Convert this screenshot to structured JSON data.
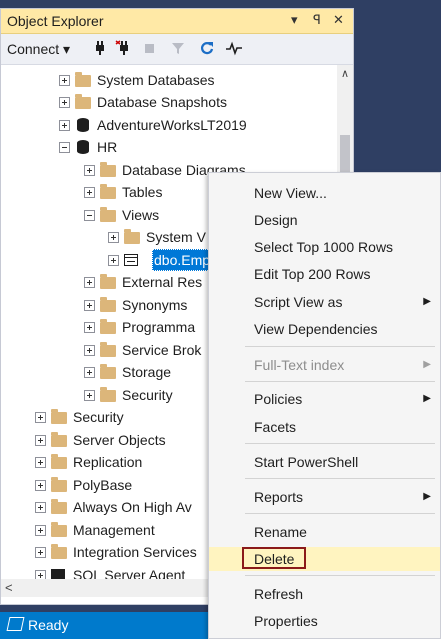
{
  "panel": {
    "title": "Object Explorer",
    "title_icons": [
      "▾",
      "ꟼ",
      "✕"
    ],
    "toolbar": {
      "connect_label": "Connect ▾",
      "icons": [
        "plug-icon",
        "disconnect-icon",
        "stop-icon",
        "filter-icon",
        "refresh-icon",
        "activity-icon"
      ]
    }
  },
  "tree": [
    {
      "label": "System Databases",
      "icon": "folder",
      "expander": "plus"
    },
    {
      "label": "Database Snapshots",
      "icon": "folder",
      "expander": "plus"
    },
    {
      "label": "AdventureWorksLT2019",
      "icon": "database",
      "expander": "plus"
    },
    {
      "label": "HR",
      "icon": "database",
      "expander": "minus"
    },
    {
      "label": "Database Diagrams",
      "icon": "folder",
      "expander": "plus"
    },
    {
      "label": "Tables",
      "icon": "folder",
      "expander": "plus"
    },
    {
      "label": "Views",
      "icon": "folder",
      "expander": "minus"
    },
    {
      "label": "System V",
      "icon": "folder",
      "expander": "plus"
    },
    {
      "label": "dbo.Emp",
      "icon": "view",
      "expander": "plus",
      "selected": true
    },
    {
      "label": "External Res",
      "icon": "folder",
      "expander": "plus"
    },
    {
      "label": "Synonyms",
      "icon": "folder",
      "expander": "plus"
    },
    {
      "label": "Programma",
      "icon": "folder",
      "expander": "plus"
    },
    {
      "label": "Service Brok",
      "icon": "folder",
      "expander": "plus"
    },
    {
      "label": "Storage",
      "icon": "folder",
      "expander": "plus"
    },
    {
      "label": "Security",
      "icon": "folder",
      "expander": "plus"
    },
    {
      "label": "Security",
      "icon": "folder",
      "expander": "plus"
    },
    {
      "label": "Server Objects",
      "icon": "folder",
      "expander": "plus"
    },
    {
      "label": "Replication",
      "icon": "folder",
      "expander": "plus"
    },
    {
      "label": "PolyBase",
      "icon": "folder",
      "expander": "plus"
    },
    {
      "label": "Always On High Av",
      "icon": "folder",
      "expander": "plus"
    },
    {
      "label": "Management",
      "icon": "folder",
      "expander": "plus"
    },
    {
      "label": "Integration Services",
      "icon": "folder",
      "expander": "plus"
    },
    {
      "label": "SQL Server Agent",
      "icon": "agent",
      "expander": "plus"
    }
  ],
  "context_menu": [
    {
      "label": "New View...",
      "submenu": false
    },
    {
      "label": "Design",
      "submenu": false
    },
    {
      "label": "Select Top 1000 Rows",
      "submenu": false
    },
    {
      "label": "Edit Top 200 Rows",
      "submenu": false
    },
    {
      "label": "Script View as",
      "submenu": true
    },
    {
      "label": "View Dependencies",
      "submenu": false
    },
    {
      "label": "Full-Text index",
      "submenu": true,
      "disabled": true
    },
    {
      "label": "Policies",
      "submenu": true
    },
    {
      "label": "Facets",
      "submenu": false
    },
    {
      "label": "Start PowerShell",
      "submenu": false
    },
    {
      "label": "Reports",
      "submenu": true
    },
    {
      "label": "Rename",
      "submenu": false
    },
    {
      "label": "Delete",
      "submenu": false,
      "highlighted": true
    },
    {
      "label": "Refresh",
      "submenu": false
    },
    {
      "label": "Properties",
      "submenu": false
    }
  ],
  "status": {
    "text": "Ready"
  },
  "colors": {
    "title_bar": "#ffe9a6",
    "status_bar": "#007acc",
    "selection": "#0078d7",
    "highlight": "#fff4c0",
    "highlight_border": "#8b1a1a"
  }
}
